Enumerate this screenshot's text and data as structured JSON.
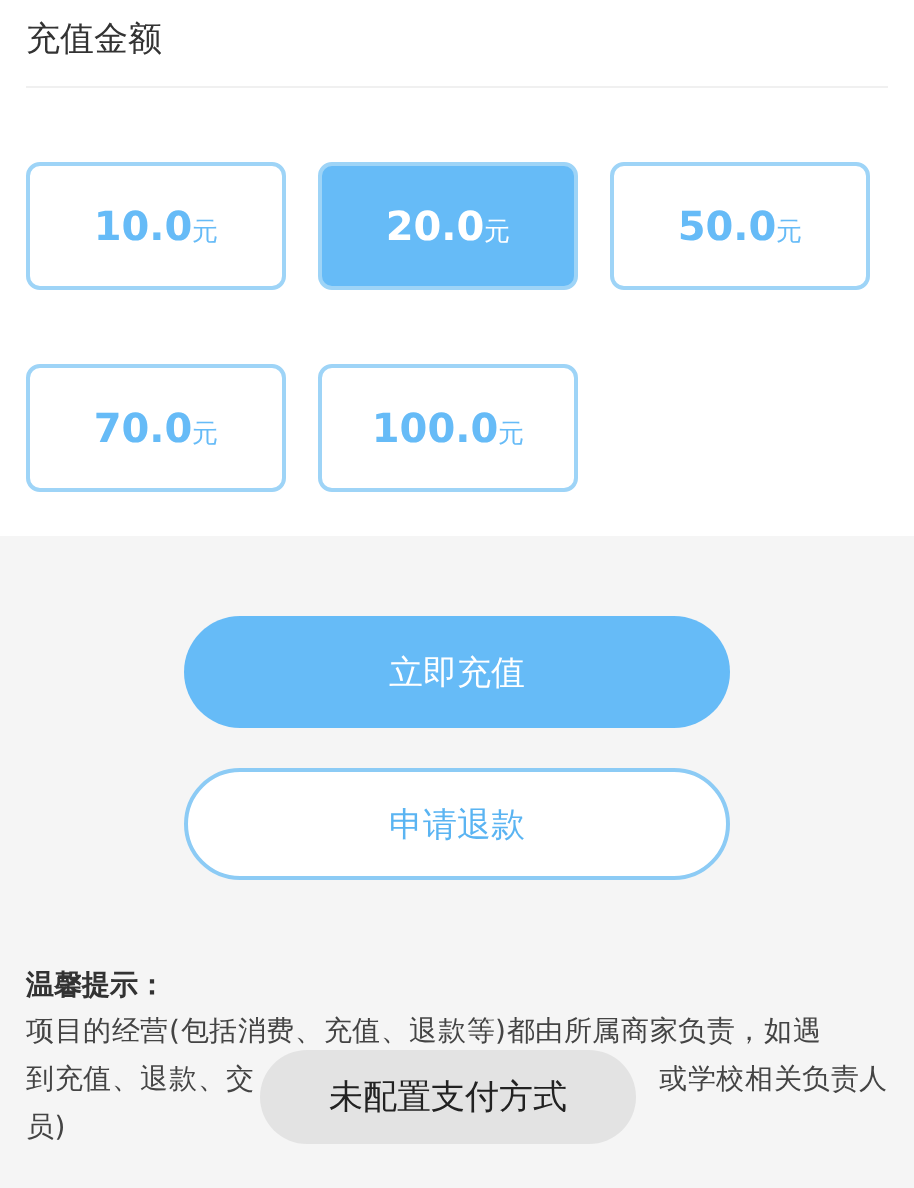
{
  "section_title": "充值金额",
  "amounts": [
    {
      "amount": "10.0",
      "unit": "元",
      "selected": false
    },
    {
      "amount": "20.0",
      "unit": "元",
      "selected": true
    },
    {
      "amount": "50.0",
      "unit": "元",
      "selected": false
    },
    {
      "amount": "70.0",
      "unit": "元",
      "selected": false
    },
    {
      "amount": "100.0",
      "unit": "元",
      "selected": false
    }
  ],
  "actions": [
    {
      "label": "立即充值",
      "kind": "primary"
    },
    {
      "label": "申请退款",
      "kind": "outline"
    }
  ],
  "notice": {
    "title": "温馨提示：",
    "lines": [
      [
        "项目的经营(包括消费、充值、退款等)都由所属商家负责，如遇"
      ],
      [
        "到充值、退款、交",
        "或学校相关负责人"
      ],
      [
        "员)"
      ]
    ]
  },
  "toast": "未配置支付方式"
}
